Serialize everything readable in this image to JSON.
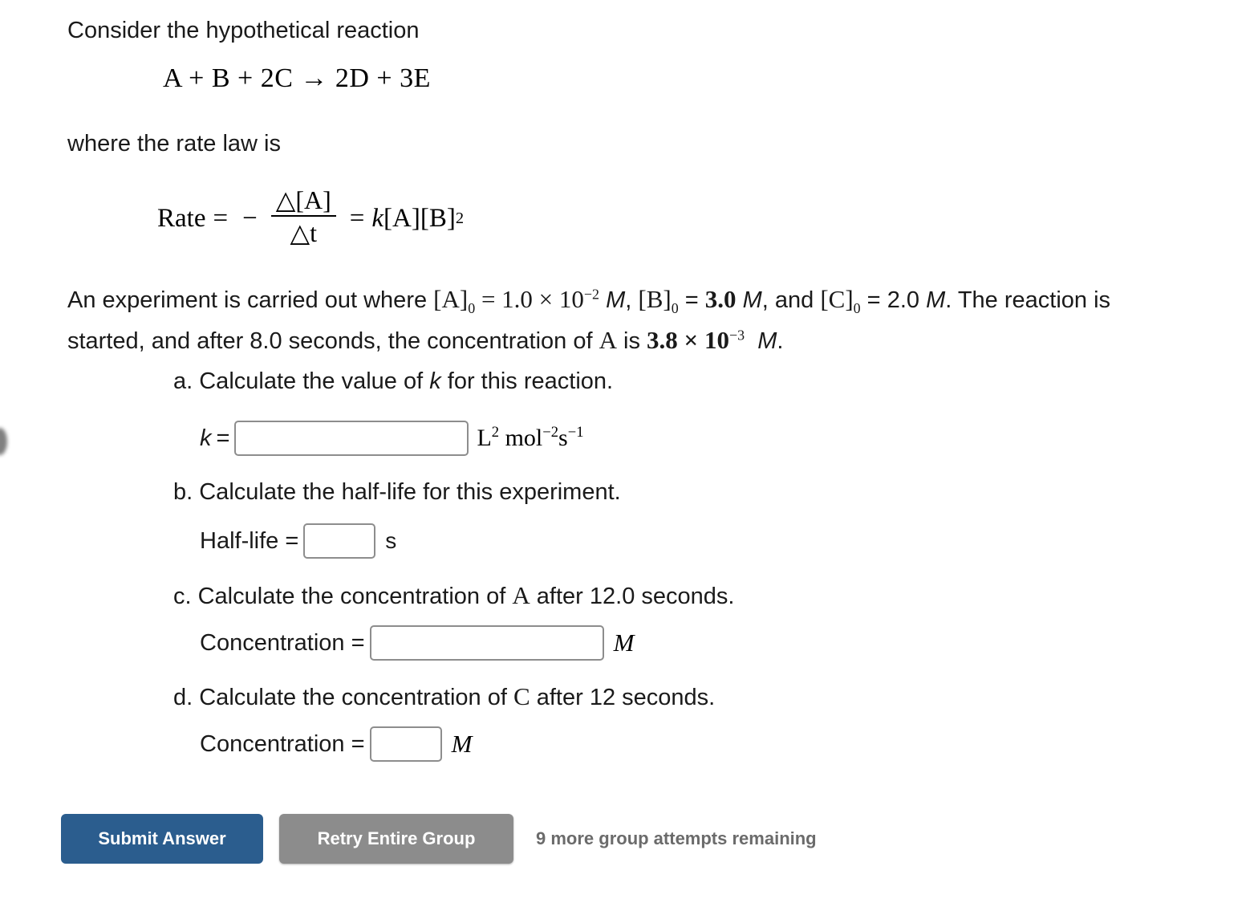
{
  "intro": {
    "line": "Consider the hypothetical reaction"
  },
  "reaction": {
    "equation": "A + B + 2C → 2D + 3E",
    "reactants": [
      "A",
      "B",
      "2C"
    ],
    "products": [
      "2D",
      "3E"
    ],
    "arrow": "→"
  },
  "ratelaw": {
    "intro": "where the rate law is",
    "label": "Rate",
    "equals1": "=",
    "minus": "−",
    "numerator": "△[A]",
    "denominator": "△t",
    "equals2": "=",
    "expression_k": "k",
    "expression_a": "[A]",
    "expression_b": "[B]",
    "expression_b_exponent": "2"
  },
  "experiment": {
    "t1": "An experiment is carried out where ",
    "a0_symbol": "[A]",
    "a0_sub": "0",
    "eq1": " = ",
    "a0_value": "1.0 × 10",
    "a0_exp": "−2",
    "unit_m1": "M",
    "comma1": ", ",
    "b0_symbol": "[B]",
    "b0_sub": "0",
    "eq2": " = ",
    "b0_value": "3.0",
    "unit_m2": "M",
    "comma2": ", and ",
    "c0_symbol": "[C]",
    "c0_sub": "0",
    "eq3": " = ",
    "c0_value": "2.0",
    "unit_m3": "M",
    "t2": ". The reaction is started, and after 8.0 seconds, the concentration of ",
    "species_a": "A",
    "t3": " is ",
    "a_final_value": "3.8 × 10",
    "a_final_exp": "−3",
    "unit_m4": "M",
    "period": "."
  },
  "parts": {
    "a": {
      "label": "a. Calculate the value of k for this reaction.",
      "label_prefix": "a. Calculate the value of ",
      "label_var": "k",
      "label_suffix": " for this reaction.",
      "field_lead": "k",
      "field_equals": "=",
      "field_value": "",
      "field_placeholder": "",
      "unit_l": "L",
      "unit_l_exp": "2",
      "unit_mol": "mol",
      "unit_mol_exp": "−2",
      "unit_s": "s",
      "unit_s_exp": "−1"
    },
    "b": {
      "label": "b. Calculate the half-life for this experiment.",
      "field_lead": "Half-life =",
      "field_value": "",
      "field_placeholder": "",
      "unit": "s"
    },
    "c": {
      "label_prefix": "c. Calculate the concentration of ",
      "label_species": "A",
      "label_suffix": " after 12.0 seconds.",
      "field_lead": "Concentration =",
      "field_value": "",
      "field_placeholder": "",
      "unit": "M"
    },
    "d": {
      "label_prefix": "d. Calculate the concentration of ",
      "label_species": "C",
      "label_suffix": " after 12 seconds.",
      "field_lead": "Concentration =",
      "field_value": "",
      "field_placeholder": "",
      "unit": "M"
    }
  },
  "footer": {
    "submit_label": "Submit Answer",
    "retry_label": "Retry Entire Group",
    "attempts_text": "9 more group attempts remaining"
  },
  "colors": {
    "submit_blue": "#2b5d8e",
    "retry_gray": "#8c8c8c",
    "attempts_gray": "#6b6b6b",
    "input_border": "#8d8d8d",
    "text": "#1a1a1a"
  }
}
